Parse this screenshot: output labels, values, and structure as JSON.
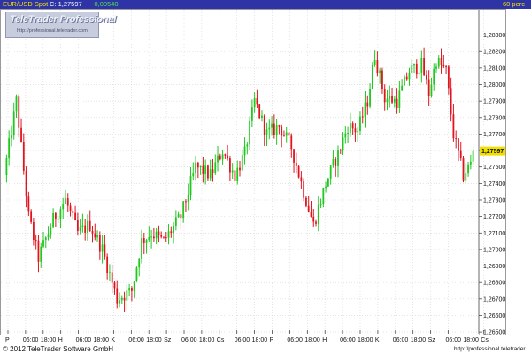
{
  "header": {
    "symbol_label": "EUR/USD Spot",
    "close_label": "C: 1,27597",
    "change_label": "-0,00540",
    "period_label": "60 perc"
  },
  "logo": {
    "title": "TeleTrader Professional",
    "url": "http://professional.teletrader.com"
  },
  "footer": {
    "copyright": "© 2012 TeleTrader Software GmbH",
    "website": "http://professional.teletrader"
  },
  "colors": {
    "header_background": "#2e34a6",
    "up_candle": "#1ec81e",
    "down_candle": "#e0141e",
    "last_price_marker": "#f0e000",
    "grid": "#d4d4d4"
  },
  "chart_data": {
    "type": "candlestick",
    "title": "EUR/USD Spot",
    "interval": "60 perc",
    "ylim": [
      1.265,
      1.283
    ],
    "last_price": 1.27597,
    "last_price_label": "1,27597",
    "grid": true,
    "y_ticks": [
      "1,26500",
      "1,26600",
      "1,26700",
      "1,26800",
      "1,26900",
      "1,27000",
      "1,27100",
      "1,27200",
      "1,27300",
      "1,27400",
      "1,27500",
      "1,27600",
      "1,27700",
      "1,27800",
      "1,27900",
      "1,28000",
      "1,28100",
      "1,28200",
      "1,28300"
    ],
    "x_ticks": [
      "P",
      "06:00",
      "18:00",
      "H",
      "06:00",
      "18:00",
      "K",
      "06:00",
      "18:00",
      "Sz",
      "06:00",
      "18:00",
      "Cs",
      "06:00",
      "18:00",
      "P",
      "06:00",
      "18:00",
      "H",
      "06:00",
      "18:00",
      "K",
      "06:00",
      "18:00",
      "Sz",
      "06:00",
      "18:00",
      "Cs"
    ],
    "anchor_points": [
      [
        0,
        1.2745
      ],
      [
        5,
        1.279
      ],
      [
        10,
        1.272
      ],
      [
        14,
        1.2695
      ],
      [
        20,
        1.2718
      ],
      [
        25,
        1.273
      ],
      [
        30,
        1.271
      ],
      [
        35,
        1.2715
      ],
      [
        40,
        1.27
      ],
      [
        46,
        1.267
      ],
      [
        52,
        1.2675
      ],
      [
        56,
        1.2705
      ],
      [
        60,
        1.271
      ],
      [
        65,
        1.2705
      ],
      [
        72,
        1.272
      ],
      [
        78,
        1.275
      ],
      [
        84,
        1.2745
      ],
      [
        89,
        1.276
      ],
      [
        94,
        1.2745
      ],
      [
        98,
        1.2758
      ],
      [
        102,
        1.279
      ],
      [
        107,
        1.277
      ],
      [
        112,
        1.2775
      ],
      [
        117,
        1.2762
      ],
      [
        122,
        1.2735
      ],
      [
        126,
        1.2715
      ],
      [
        131,
        1.274
      ],
      [
        136,
        1.2758
      ],
      [
        140,
        1.2775
      ],
      [
        144,
        1.2772
      ],
      [
        148,
        1.279
      ],
      [
        151,
        1.2818
      ],
      [
        155,
        1.2792
      ],
      [
        160,
        1.279
      ],
      [
        165,
        1.2808
      ],
      [
        170,
        1.2812
      ],
      [
        173,
        1.2795
      ],
      [
        176,
        1.2815
      ],
      [
        180,
        1.2808
      ],
      [
        183,
        1.277
      ],
      [
        187,
        1.2745
      ],
      [
        190,
        1.2752
      ]
    ],
    "candles_shown": 191
  }
}
